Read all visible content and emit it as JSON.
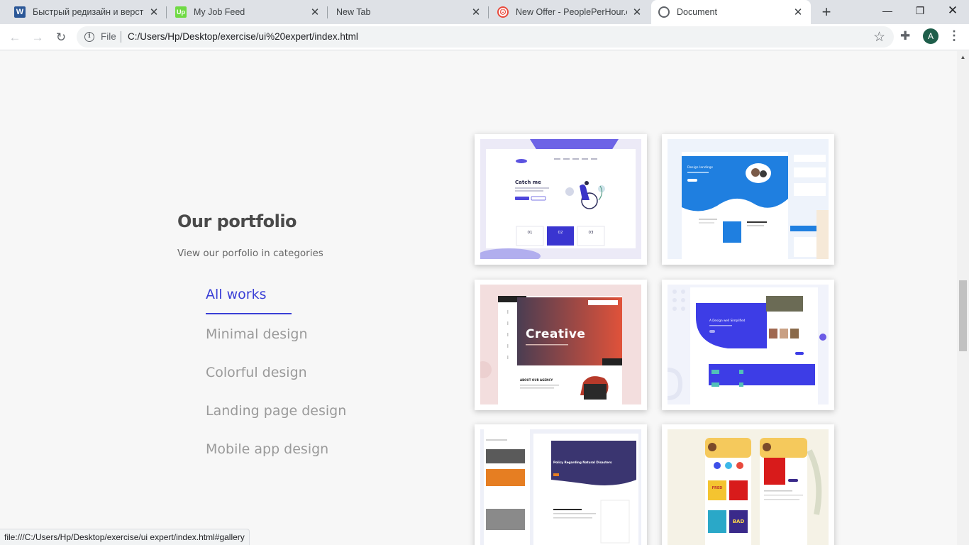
{
  "browser": {
    "tabs": [
      {
        "label": "Быстрый редизайн и верстка",
        "favicon": "word-icon"
      },
      {
        "label": "My Job Feed",
        "favicon": "upwork-icon"
      },
      {
        "label": "New Tab",
        "favicon": ""
      },
      {
        "label": "New Offer - PeoplePerHour.com",
        "favicon": "peopleperhour-icon"
      },
      {
        "label": "Document",
        "favicon": "globe-icon",
        "active": true
      }
    ],
    "favicon_letters": {
      "word": "W",
      "upwork": "Up",
      "pph": "☹"
    },
    "url_scheme_label": "File",
    "url": "C:/Users/Hp/Desktop/exercise/ui%20expert/index.html",
    "profile_initial": "A",
    "status_url": "file:///C:/Users/Hp/Desktop/exercise/ui expert/index.html#gallery"
  },
  "portfolio": {
    "title": "Our portfolio",
    "subtitle": "View our porfolio in categories",
    "categories": [
      {
        "label": "All works",
        "active": true
      },
      {
        "label": "Minimal design",
        "active": false
      },
      {
        "label": "Colorful design",
        "active": false
      },
      {
        "label": "Landing page design",
        "active": false
      },
      {
        "label": "Mobile app design",
        "active": false
      }
    ],
    "gallery": [
      {
        "name": "catch-me-landing",
        "headline": "Catch me",
        "steps": [
          "01",
          "02",
          "03"
        ]
      },
      {
        "name": "blue-wave-landing",
        "headline": "Design landings"
      },
      {
        "name": "creative-agency",
        "headline": "Creative",
        "section": "ABOUT OUR AGENCY"
      },
      {
        "name": "simplified-design",
        "headline": "A Design well Simplified"
      },
      {
        "name": "natural-disasters",
        "headline": "Policy Regarding Natural Disasters"
      },
      {
        "name": "book-store-app",
        "book_titles": [
          "FRED",
          "BAD"
        ]
      }
    ]
  },
  "colors": {
    "accent": "#3a3fd6",
    "page_bg": "#f7f7f7"
  }
}
